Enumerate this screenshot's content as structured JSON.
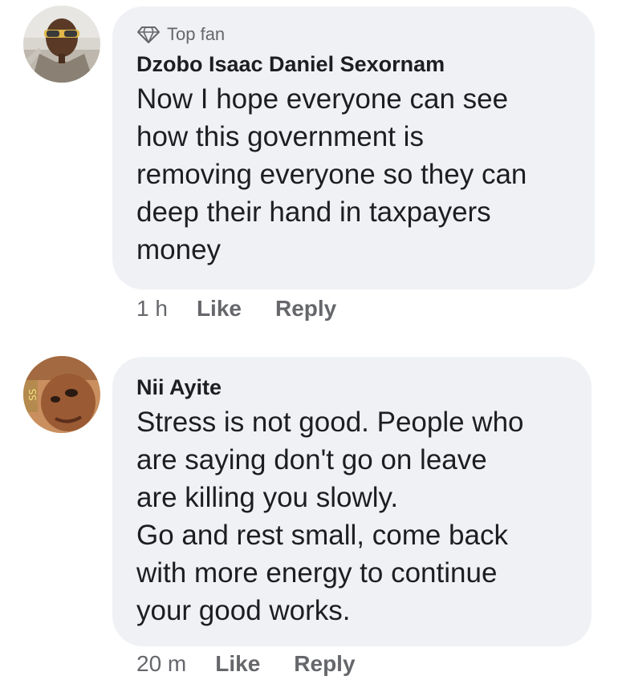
{
  "comments": [
    {
      "badge": "Top fan",
      "badge_icon": "diamond-icon",
      "author": "Dzobo Isaac Daniel Sexornam",
      "text": "Now I hope everyone can see\nhow this government is\nremoving everyone so they can\ndeep their hand in taxpayers\nmoney",
      "time": "1 h",
      "like_label": "Like",
      "reply_label": "Reply"
    },
    {
      "author": "Nii Ayite",
      "text": "Stress is not good. People who\nare saying don't go on leave\nare killing you slowly.\nGo and rest small, come back\nwith more energy to continue\nyour good works.",
      "time": "20 m",
      "like_label": "Like",
      "reply_label": "Reply"
    }
  ],
  "colors": {
    "bubble": "#eff1f4",
    "text": "#1c1e21",
    "secondary": "#65676b"
  }
}
